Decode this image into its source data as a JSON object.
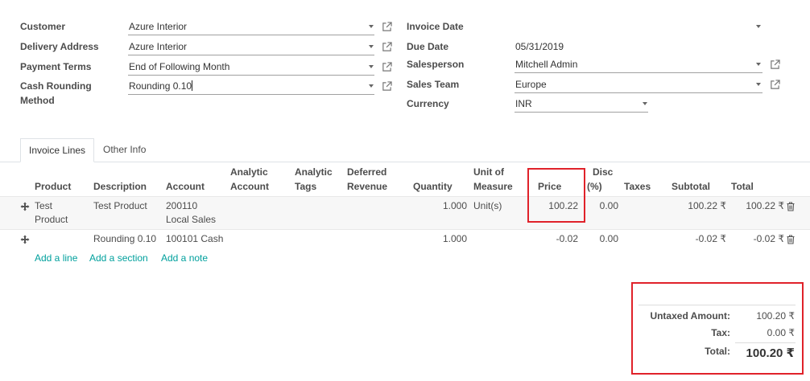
{
  "form": {
    "left": [
      {
        "label": "Customer",
        "value": "Azure Interior"
      },
      {
        "label": "Delivery Address",
        "value": "Azure Interior"
      },
      {
        "label": "Payment Terms",
        "value": "End of Following Month"
      },
      {
        "label_line1": "Cash Rounding",
        "label_line2": "Method",
        "value": "Rounding 0.10"
      }
    ],
    "right": [
      {
        "label": "Invoice Date",
        "value": ""
      },
      {
        "label": "Due Date",
        "value": "05/31/2019"
      },
      {
        "label": "Salesperson",
        "value": "Mitchell Admin"
      },
      {
        "label": "Sales Team",
        "value": "Europe"
      },
      {
        "label": "Currency",
        "value": "INR"
      }
    ]
  },
  "tabs": [
    {
      "label": "Invoice Lines",
      "active": true
    },
    {
      "label": "Other Info",
      "active": false
    }
  ],
  "table": {
    "headers": {
      "product": "Product",
      "description": "Description",
      "account": "Account",
      "analytic_account_1": "Analytic",
      "analytic_account_2": "Account",
      "analytic_tags_1": "Analytic",
      "analytic_tags_2": "Tags",
      "deferred_1": "Deferred",
      "deferred_2": "Revenue",
      "quantity": "Quantity",
      "uom_1": "Unit of",
      "uom_2": "Measure",
      "price": "Price",
      "disc_1": "Disc",
      "disc_2": "(%)",
      "taxes": "Taxes",
      "subtotal": "Subtotal",
      "total": "Total"
    },
    "rows": [
      {
        "product_1": "Test",
        "product_2": "Product",
        "description": "Test Product",
        "account_1": "200110",
        "account_2": "Local Sales",
        "quantity": "1.000",
        "uom": "Unit(s)",
        "price": "100.22",
        "disc": "0.00",
        "subtotal": "100.22 ₹",
        "total": "100.22 ₹"
      },
      {
        "product_1": "",
        "product_2": "",
        "description": "Rounding 0.10",
        "account_1": "100101 Cash",
        "account_2": "",
        "quantity": "1.000",
        "uom": "",
        "price": "-0.02",
        "disc": "0.00",
        "subtotal": "-0.02 ₹",
        "total": "-0.02 ₹"
      }
    ],
    "actions": {
      "add_line": "Add a line",
      "add_section": "Add a section",
      "add_note": "Add a note"
    }
  },
  "totals": {
    "untaxed_label": "Untaxed Amount:",
    "untaxed_value": "100.20 ₹",
    "tax_label": "Tax:",
    "tax_value": "0.00 ₹",
    "total_label": "Total:",
    "total_value": "100.20 ₹"
  },
  "colors": {
    "link": "#00A09D",
    "highlight": "#e0222a"
  }
}
